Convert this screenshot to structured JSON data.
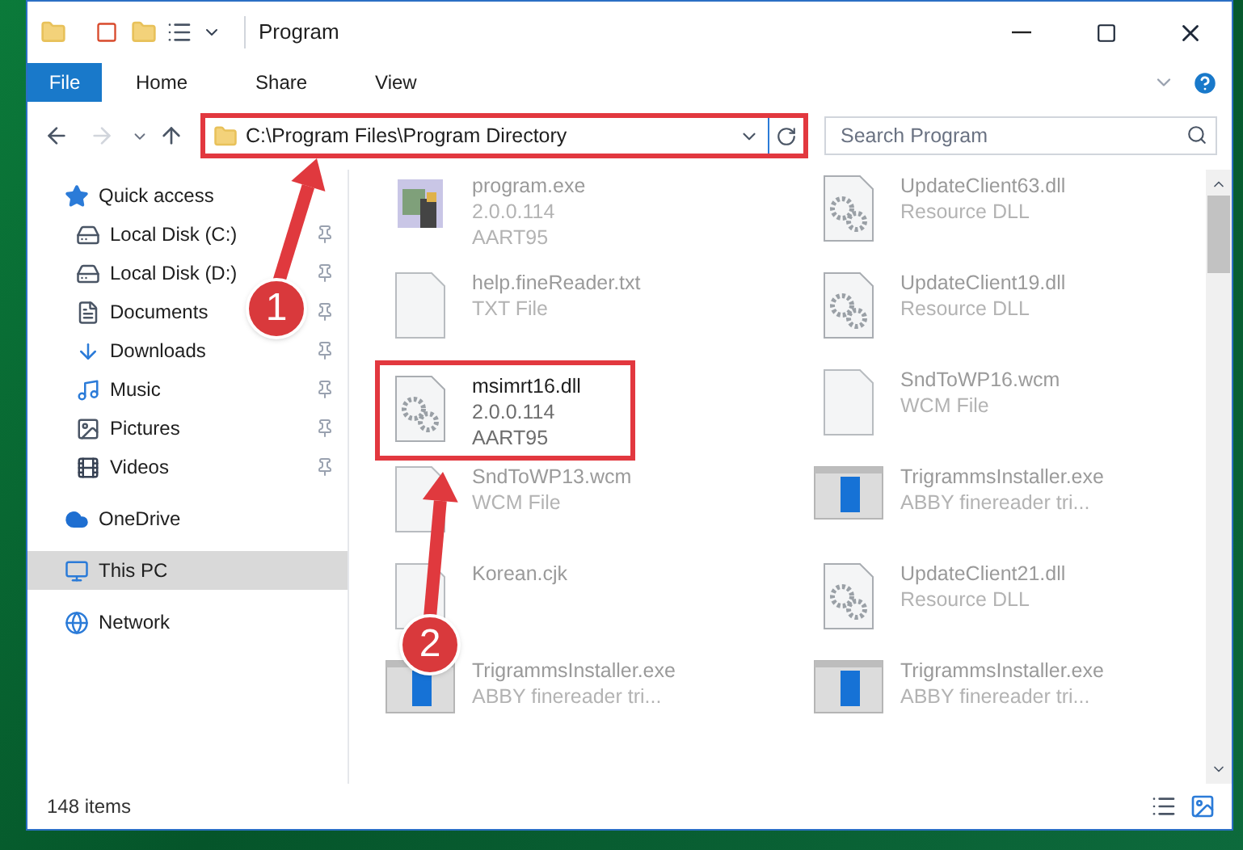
{
  "window": {
    "title": "Program"
  },
  "ribbon_tabs": [
    {
      "label": "File",
      "selected": true
    },
    {
      "label": "Home",
      "selected": false
    },
    {
      "label": "Share",
      "selected": false
    },
    {
      "label": "View",
      "selected": false
    }
  ],
  "address_bar": {
    "path": "C:\\Program Files\\Program Directory",
    "highlighted": true
  },
  "search": {
    "placeholder": "Search Program"
  },
  "sidebar": {
    "items": [
      {
        "label": "Quick access",
        "selected": false,
        "children": [
          {
            "label": "Local Disk (C:)",
            "pinned": true
          },
          {
            "label": "Local Disk (D:)",
            "pinned": true
          },
          {
            "label": "Documents",
            "pinned": true
          },
          {
            "label": "Downloads",
            "pinned": true
          },
          {
            "label": "Music",
            "pinned": true
          },
          {
            "label": "Pictures",
            "pinned": true
          },
          {
            "label": "Videos",
            "pinned": true
          }
        ]
      },
      {
        "label": "OneDrive",
        "selected": false
      },
      {
        "label": "This PC",
        "selected": true
      },
      {
        "label": "Network",
        "selected": false
      }
    ]
  },
  "files": [
    {
      "kind": "exe",
      "name": "program.exe",
      "details": [
        "2.0.0.114",
        "AART95"
      ],
      "highlighted": false
    },
    {
      "kind": "dll",
      "name": "UpdateClient63.dll",
      "details": [
        "Resource DLL"
      ],
      "highlighted": false
    },
    {
      "kind": "blank",
      "name": "help.fineReader.txt",
      "details": [
        "TXT File"
      ],
      "highlighted": false
    },
    {
      "kind": "dll",
      "name": "UpdateClient19.dll",
      "details": [
        "Resource DLL"
      ],
      "highlighted": false
    },
    {
      "kind": "dll",
      "name": "msimrt16.dll",
      "details": [
        "2.0.0.114",
        "AART95"
      ],
      "highlighted": true
    },
    {
      "kind": "blank",
      "name": "SndToWP16.wcm",
      "details": [
        "WCM File"
      ],
      "highlighted": false
    },
    {
      "kind": "blank",
      "name": "SndToWP13.wcm",
      "details": [
        "WCM File"
      ],
      "highlighted": false
    },
    {
      "kind": "installer",
      "name": "TrigrammsInstaller.exe",
      "details": [
        "ABBY finereader tri..."
      ],
      "highlighted": false
    },
    {
      "kind": "blank",
      "name": "Korean.cjk",
      "highlighted": false
    },
    {
      "kind": "dll",
      "name": "UpdateClient21.dll",
      "details": [
        "Resource DLL"
      ],
      "highlighted": false
    },
    {
      "kind": "installer",
      "name": "TrigrammsInstaller.exe",
      "details": [
        "ABBY finereader tri..."
      ],
      "highlighted": false
    },
    {
      "kind": "installer",
      "name": "TrigrammsInstaller.exe",
      "details": [
        "ABBY finereader tri..."
      ],
      "highlighted": false
    }
  ],
  "status_bar": {
    "count": "148 items"
  },
  "annotations": [
    {
      "label": "1"
    },
    {
      "label": "2"
    }
  ]
}
